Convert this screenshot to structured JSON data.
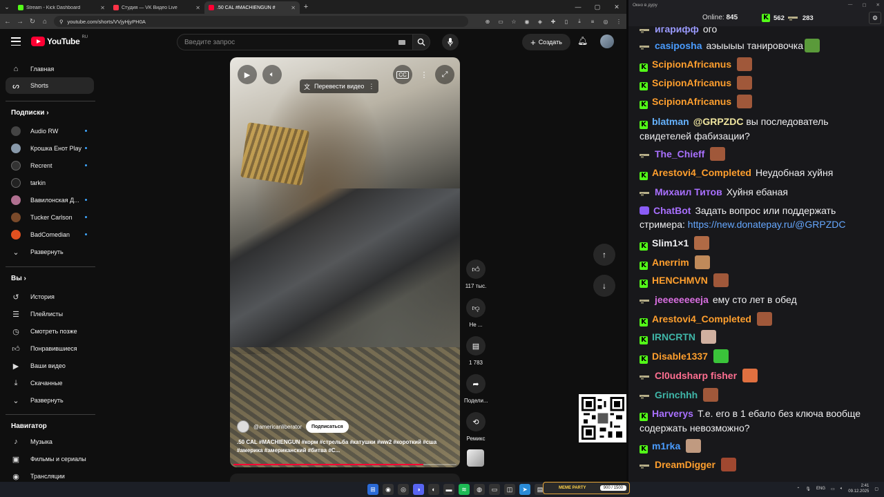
{
  "browser": {
    "tabs": [
      {
        "title": "Stream - Kick Dashboard",
        "color": "#53fc18",
        "active": false
      },
      {
        "title": "Студия — VK Видео Live",
        "color": "#ff3347",
        "active": false
      },
      {
        "title": ".50 CAL #MACHIENGUN #",
        "color": "#ff0033",
        "active": true
      }
    ],
    "url": "youtube.com/shorts/VVjyHjyPH0A"
  },
  "youtube": {
    "logo_text": "YouTube",
    "logo_country": "RU",
    "search_placeholder": "Введите запрос",
    "create_label": "Создать",
    "nav": {
      "home": "Главная",
      "shorts": "Shorts"
    },
    "subscriptions_heading": "Подписки",
    "subscriptions": [
      {
        "name": "Audio RW",
        "color": "#444"
      },
      {
        "name": "Крошка Енот Play",
        "color": "#8899aa"
      },
      {
        "name": "Recrent",
        "color": "#333"
      },
      {
        "name": "tarkin",
        "color": "#222"
      },
      {
        "name": "Вавилонская Д...",
        "color": "#b07090"
      },
      {
        "name": "Tucker Carlson",
        "color": "#7a4a2a"
      },
      {
        "name": "BadComedian",
        "color": "#e05020"
      }
    ],
    "expand_label": "Развернуть",
    "you_heading": "Вы",
    "you_items": [
      "История",
      "Плейлисты",
      "Смотреть позже",
      "Понравившиеся",
      "Ваши видео",
      "Скачанные",
      "Развернуть"
    ],
    "navigator_heading": "Навигатор",
    "navigator_items": [
      "Музыка",
      "Фильмы и сериалы",
      "Трансляции"
    ]
  },
  "video": {
    "translate_label": "Перевести видео",
    "channel": "@americanliberator",
    "subscribe_label": "Подписаться",
    "description": ".50 CAL #MACHIENGUN #корм #стрельба #катушки #ww2 #короткий #сша #америка #американский #битва #С...",
    "progress": 0.85,
    "actions": {
      "likes": "117 тыс.",
      "dislike": "Не ...",
      "comments": "1 783",
      "share": "Подели...",
      "remix": "Ремикс"
    }
  },
  "taskbar": {
    "meme_label": "MEME PARTY",
    "meme_value": "900 / 1500",
    "lang": "ENG",
    "time": "2:41",
    "date": "09.12.2025"
  },
  "chat": {
    "window_title": "Окно в дуру",
    "online_label": "Online:",
    "online_count": "845",
    "kick_count": "562",
    "vk_count": "283",
    "messages": [
      {
        "badge": "gun",
        "user": "игарифф",
        "color": "#9b9bff",
        "text": "ого",
        "emote": ""
      },
      {
        "badge": "gun",
        "user": "casiposha",
        "color": "#4a9cff",
        "text": "аэыыыы танировочка",
        "emote": "#5a9a3a"
      },
      {
        "badge": "kick",
        "user": "ScipionAfricanus",
        "color": "#ff9f2e",
        "text": "",
        "emote": "#a0583a"
      },
      {
        "badge": "kick",
        "user": "ScipionAfricanus",
        "color": "#ff9f2e",
        "text": "",
        "emote": "#a0583a"
      },
      {
        "badge": "kick",
        "user": "ScipionAfricanus",
        "color": "#ff9f2e",
        "text": "",
        "emote": "#a0583a"
      },
      {
        "badge": "kick",
        "user": "blatman",
        "color": "#66b3ff",
        "text": "вы последователь свидетелей фабизации?",
        "mention": "@GRPZDC",
        "emote": ""
      },
      {
        "badge": "gun",
        "user": "The_Chieff",
        "color": "#a970ff",
        "text": "",
        "emote": "#a0583a"
      },
      {
        "badge": "kick",
        "user": "Arestovi4_Completed",
        "color": "#ff9f2e",
        "text": "Неудобная хуйня",
        "emote": ""
      },
      {
        "badge": "gun",
        "user": "Михаил Титов",
        "color": "#a970ff",
        "text": "Хуйня ебаная",
        "emote": ""
      },
      {
        "badge": "bot",
        "user": "ChatBot",
        "color": "#a970ff",
        "text": "Задать вопрос или поддержать стримера: ",
        "link": "https://new.donatepay.ru/@GRPZDC",
        "emote": ""
      },
      {
        "badge": "kick",
        "user": "Slim1×1",
        "color": "#efeff1",
        "text": "",
        "emote": "#b06a45"
      },
      {
        "badge": "kick",
        "user": "Anerrim",
        "color": "#ff9f2e",
        "text": "",
        "emote": "#c08a5a"
      },
      {
        "badge": "kick",
        "user": "HENCHMVN",
        "color": "#ff9f2e",
        "text": "",
        "emote": "#a0583a"
      },
      {
        "badge": "gun",
        "user": "jeeeeeeeeja",
        "color": "#d86ee0",
        "text": "ему сто лет в обед",
        "emote": ""
      },
      {
        "badge": "kick",
        "user": "Arestovi4_Completed",
        "color": "#ff9f2e",
        "text": "",
        "emote": "#a0583a"
      },
      {
        "badge": "kick",
        "user": "IRNCRTN",
        "color": "#3fb6a8",
        "text": "",
        "emote": "#d0b0a0"
      },
      {
        "badge": "kick",
        "user": "Disable1337",
        "color": "#ff9f2e",
        "text": "",
        "emote": "#3ac43a"
      },
      {
        "badge": "gun",
        "user": "Cl0udsharp fisher",
        "color": "#ff6f91",
        "text": "",
        "emote": "#e07040"
      },
      {
        "badge": "gun",
        "user": "Grinchhh",
        "color": "#3fb6a8",
        "text": "",
        "emote": "#a0583a"
      },
      {
        "badge": "kick",
        "user": "Harverys",
        "color": "#a970ff",
        "text": "Т.е. его в 1 ебало без ключа вообще содержать невозможно?",
        "emote": ""
      },
      {
        "badge": "kick",
        "user": "m1rka",
        "color": "#4a9cff",
        "text": "",
        "emote": "#c09a80"
      },
      {
        "badge": "gun",
        "user": "DreamDigger",
        "color": "#ff9f2e",
        "text": "",
        "emote": "#a04830"
      }
    ]
  }
}
